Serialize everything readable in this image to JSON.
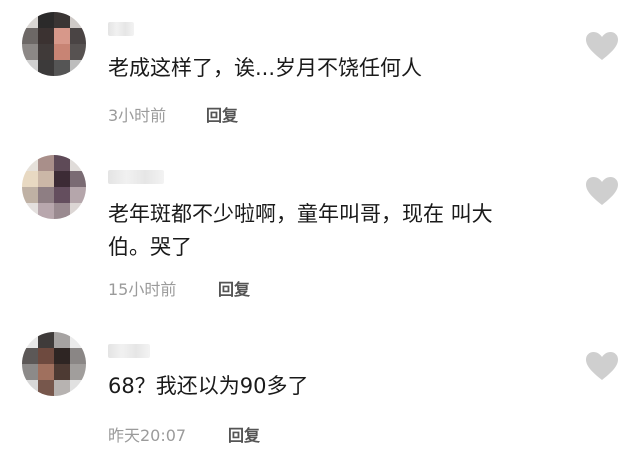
{
  "comments": [
    {
      "text": "老成这样了，诶...岁月不饶任何人",
      "time": "3小时前",
      "reply_label": "回复"
    },
    {
      "text": "老年斑都不少啦啊，童年叫哥，现在 叫大伯。哭了",
      "time": "15小时前",
      "reply_label": "回复"
    },
    {
      "text": "68？我还以为90多了",
      "time": "昨天20:07",
      "reply_label": "回复"
    }
  ],
  "colors": {
    "heart": "#cfcfcf",
    "meta": "#9b9b9b",
    "text": "#1a1a1a"
  },
  "icons": {
    "like": "heart-icon",
    "avatar": "avatar"
  }
}
